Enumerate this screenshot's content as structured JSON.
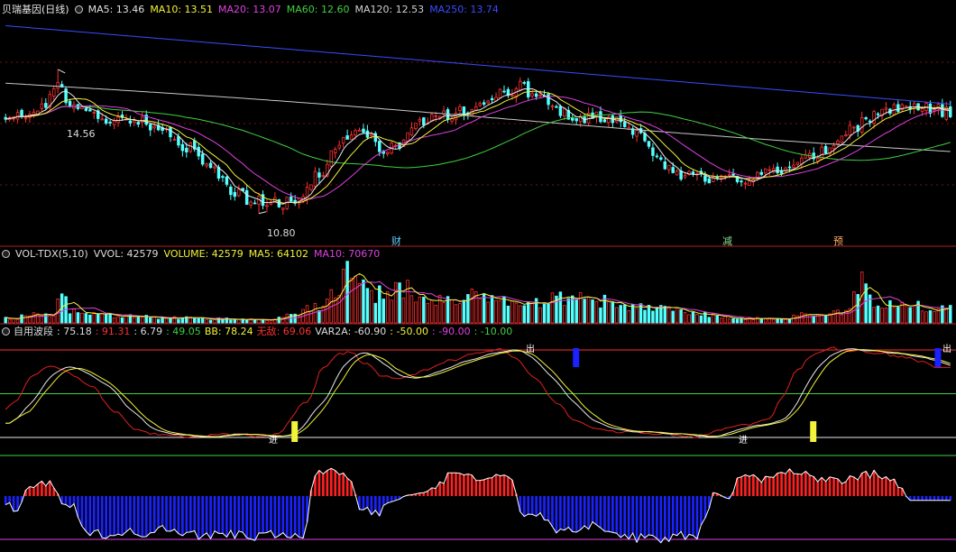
{
  "panels": {
    "price": {
      "title": "贝瑞基因(日线)",
      "indicators": [
        {
          "label": "MA5: 13.46",
          "color": "#e0e0e0"
        },
        {
          "label": "MA10: 13.51",
          "color": "#f2f23a"
        },
        {
          "label": "MA20: 13.07",
          "color": "#e040e0"
        },
        {
          "label": "MA60: 12.60",
          "color": "#40d040"
        },
        {
          "label": "MA120: 12.53",
          "color": "#d0d0d0"
        },
        {
          "label": "MA250: 13.74",
          "color": "#3a4cff"
        }
      ],
      "high_label": "14.56",
      "low_label": "10.80",
      "markers": [
        {
          "text": "财",
          "color": "#5ad0ff"
        },
        {
          "text": "减",
          "color": "#8fe08f"
        },
        {
          "text": "预",
          "color": "#ffb060"
        }
      ]
    },
    "volume": {
      "indicators": [
        {
          "label": "VOL-TDX(5,10)",
          "color": "#dddddd"
        },
        {
          "label": "VVOL: 42579",
          "color": "#dddddd"
        },
        {
          "label": "VOLUME: 42579",
          "color": "#f2f23a"
        },
        {
          "label": "MA5: 64102",
          "color": "#f2f23a"
        },
        {
          "label": "MA10: 70670",
          "color": "#e040e0"
        }
      ]
    },
    "wave": {
      "indicators": [
        {
          "label": "自用波段",
          "color": "#dddddd"
        },
        {
          "label": ": 75.18",
          "color": "#dddddd"
        },
        {
          "label": ": 91.31",
          "color": "#ff3030"
        },
        {
          "label": ": 6.79",
          "color": "#dddddd"
        },
        {
          "label": ": 49.05",
          "color": "#40d040"
        },
        {
          "label": "BB: 78.24",
          "color": "#f2f23a"
        },
        {
          "label": "无敌: 69.06",
          "color": "#ff3030"
        },
        {
          "label": "VAR2A: -60.90",
          "color": "#dddddd"
        },
        {
          "label": ": -50.00",
          "color": "#f2f23a"
        },
        {
          "label": ": -90.00",
          "color": "#e040e0"
        },
        {
          "label": ": -10.00",
          "color": "#40d040"
        }
      ],
      "in_label": "进",
      "out_label": "出"
    }
  },
  "chart_data": {
    "type": "candlestick",
    "y_range_price": [
      10.3,
      15.9
    ],
    "price_markers_at_index": [
      97,
      179,
      206
    ],
    "high_point": {
      "index": 13,
      "value": 14.56
    },
    "low_point": {
      "index": 63,
      "value": 10.8
    },
    "candle_count": 236,
    "series": [
      "close",
      "MA5",
      "MA10",
      "MA20",
      "MA60",
      "MA120",
      "MA250",
      "VOLUME",
      "VOL MA5",
      "VOL MA10",
      "wave",
      "VAR2A"
    ],
    "anchors_close": [
      [
        0,
        13.25
      ],
      [
        6,
        13.35
      ],
      [
        10,
        13.7
      ],
      [
        13,
        14.1
      ],
      [
        16,
        13.6
      ],
      [
        22,
        13.3
      ],
      [
        30,
        13.25
      ],
      [
        38,
        13.1
      ],
      [
        46,
        12.5
      ],
      [
        52,
        11.9
      ],
      [
        56,
        11.4
      ],
      [
        62,
        11.1
      ],
      [
        68,
        11.05
      ],
      [
        73,
        11.2
      ],
      [
        78,
        11.8
      ],
      [
        84,
        12.8
      ],
      [
        89,
        13.0
      ],
      [
        94,
        12.35
      ],
      [
        98,
        12.6
      ],
      [
        103,
        13.1
      ],
      [
        108,
        13.35
      ],
      [
        112,
        13.45
      ],
      [
        118,
        13.6
      ],
      [
        123,
        13.9
      ],
      [
        128,
        14.1
      ],
      [
        133,
        13.75
      ],
      [
        138,
        13.45
      ],
      [
        145,
        13.3
      ],
      [
        152,
        13.25
      ],
      [
        158,
        12.8
      ],
      [
        164,
        12.0
      ],
      [
        170,
        11.8
      ],
      [
        176,
        11.65
      ],
      [
        182,
        11.7
      ],
      [
        188,
        11.8
      ],
      [
        194,
        11.9
      ],
      [
        200,
        12.3
      ],
      [
        206,
        12.45
      ],
      [
        210,
        13.0
      ],
      [
        215,
        13.3
      ],
      [
        220,
        13.55
      ],
      [
        226,
        13.65
      ],
      [
        231,
        13.5
      ],
      [
        235,
        13.46
      ]
    ],
    "anchors_volume": [
      [
        0,
        0.08
      ],
      [
        12,
        0.15
      ],
      [
        14,
        0.5
      ],
      [
        16,
        0.17
      ],
      [
        30,
        0.1
      ],
      [
        50,
        0.07
      ],
      [
        64,
        0.05
      ],
      [
        72,
        0.13
      ],
      [
        78,
        0.3
      ],
      [
        83,
        0.5
      ],
      [
        84,
        0.95
      ],
      [
        86,
        0.85
      ],
      [
        88,
        0.62
      ],
      [
        92,
        0.45
      ],
      [
        98,
        0.6
      ],
      [
        104,
        0.35
      ],
      [
        112,
        0.42
      ],
      [
        116,
        0.5
      ],
      [
        124,
        0.32
      ],
      [
        132,
        0.3
      ],
      [
        136,
        0.45
      ],
      [
        145,
        0.36
      ],
      [
        158,
        0.28
      ],
      [
        170,
        0.18
      ],
      [
        180,
        0.08
      ],
      [
        192,
        0.06
      ],
      [
        200,
        0.15
      ],
      [
        210,
        0.2
      ],
      [
        212,
        0.7
      ],
      [
        216,
        0.3
      ],
      [
        226,
        0.28
      ],
      [
        235,
        0.22
      ]
    ],
    "anchors_wave": [
      [
        0,
        15
      ],
      [
        5,
        40
      ],
      [
        10,
        70
      ],
      [
        14,
        82
      ],
      [
        18,
        75
      ],
      [
        24,
        60
      ],
      [
        30,
        30
      ],
      [
        36,
        8
      ],
      [
        42,
        2
      ],
      [
        50,
        1
      ],
      [
        58,
        4
      ],
      [
        66,
        1
      ],
      [
        70,
        3
      ],
      [
        78,
        40
      ],
      [
        82,
        80
      ],
      [
        86,
        95
      ],
      [
        89,
        98
      ],
      [
        92,
        85
      ],
      [
        97,
        70
      ],
      [
        102,
        68
      ],
      [
        108,
        78
      ],
      [
        114,
        88
      ],
      [
        120,
        96
      ],
      [
        126,
        101
      ],
      [
        130,
        90
      ],
      [
        134,
        70
      ],
      [
        140,
        40
      ],
      [
        145,
        18
      ],
      [
        150,
        9
      ],
      [
        158,
        6
      ],
      [
        166,
        4
      ],
      [
        172,
        1
      ],
      [
        176,
        1
      ],
      [
        182,
        10
      ],
      [
        188,
        15
      ],
      [
        193,
        22
      ],
      [
        196,
        45
      ],
      [
        200,
        78
      ],
      [
        204,
        95
      ],
      [
        208,
        102
      ],
      [
        214,
        99
      ],
      [
        220,
        97
      ],
      [
        226,
        92
      ],
      [
        231,
        86
      ],
      [
        235,
        80
      ]
    ],
    "anchors_var2a": [
      [
        0,
        -20
      ],
      [
        3,
        -28
      ],
      [
        6,
        28
      ],
      [
        9,
        35
      ],
      [
        12,
        28
      ],
      [
        14,
        -18
      ],
      [
        17,
        -25
      ],
      [
        20,
        -90
      ],
      [
        25,
        -88
      ],
      [
        30,
        -82
      ],
      [
        35,
        -86
      ],
      [
        40,
        -70
      ],
      [
        45,
        -90
      ],
      [
        50,
        -92
      ],
      [
        55,
        -86
      ],
      [
        60,
        -93
      ],
      [
        64,
        -95
      ],
      [
        68,
        -85
      ],
      [
        72,
        -90
      ],
      [
        74,
        -90
      ],
      [
        77,
        50
      ],
      [
        80,
        62
      ],
      [
        83,
        55
      ],
      [
        86,
        30
      ],
      [
        88,
        -22
      ],
      [
        92,
        -40
      ],
      [
        97,
        -10
      ],
      [
        100,
        2
      ],
      [
        104,
        8
      ],
      [
        108,
        30
      ],
      [
        111,
        58
      ],
      [
        115,
        50
      ],
      [
        119,
        44
      ],
      [
        123,
        52
      ],
      [
        126,
        45
      ],
      [
        128,
        -35
      ],
      [
        131,
        -40
      ],
      [
        134,
        -50
      ],
      [
        138,
        -85
      ],
      [
        142,
        -75
      ],
      [
        146,
        -65
      ],
      [
        150,
        -85
      ],
      [
        154,
        -95
      ],
      [
        158,
        -96
      ],
      [
        163,
        -98
      ],
      [
        168,
        -90
      ],
      [
        172,
        -90
      ],
      [
        174,
        -50
      ],
      [
        176,
        8
      ],
      [
        180,
        -6
      ],
      [
        183,
        55
      ],
      [
        187,
        42
      ],
      [
        191,
        40
      ],
      [
        195,
        60
      ],
      [
        199,
        55
      ],
      [
        203,
        40
      ],
      [
        207,
        38
      ],
      [
        211,
        45
      ],
      [
        215,
        52
      ],
      [
        218,
        44
      ],
      [
        222,
        28
      ],
      [
        225,
        -10
      ]
    ]
  }
}
